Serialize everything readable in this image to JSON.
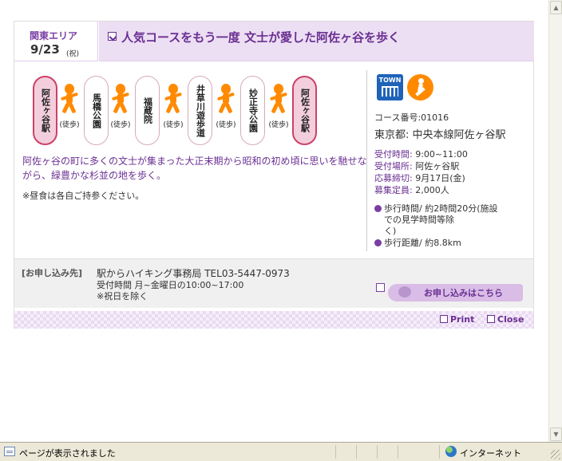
{
  "header": {
    "area": "関東エリア",
    "date": "9/23",
    "day": "(祝)",
    "title": "人気コースをもう一度 文士が愛した阿佐ヶ谷を歩く"
  },
  "route": {
    "stations": [
      "阿佐ヶ谷駅",
      "馬橋公園",
      "福蔵院",
      "井草川遊歩道",
      "妙正寺公園",
      "阿佐ヶ谷駅"
    ],
    "walk_label": "(徒歩)"
  },
  "description": "阿佐ヶ谷の町に多くの文士が集まった大正末期から昭和の初め頃に思いを馳せながら、緑豊かな杉並の地を歩く。",
  "note": "※昼食は各自ご持参ください。",
  "side": {
    "town_icon_label": "TOWN",
    "course_no": "コース番号:01016",
    "place": "東京都: 中央本線阿佐ヶ谷駅",
    "reception_time_label": "受付時間: ",
    "reception_time": "9:00~11:00",
    "reception_place_label": "受付場所: ",
    "reception_place": "阿佐ヶ谷駅",
    "deadline_label": "応募締切: ",
    "deadline": "9月17日(金)",
    "capacity_label": "募集定員: ",
    "capacity": "2,000人",
    "walk_time_1": "歩行時間/ 約2時間20分(施設",
    "walk_time_2": "での見学時間等除",
    "walk_time_3": "く)",
    "distance": "歩行距離/ 約8.8km"
  },
  "apply": {
    "label": "[お申し込み先]",
    "line1": "駅からハイキング事務局 TEL03-5447-0973",
    "line2": "受付時間 月~金曜日の10:00~17:00",
    "line3": "※祝日を除く",
    "button": "お申し込みはこちら"
  },
  "footer": {
    "print": "Print",
    "close": "Close"
  },
  "statusbar": {
    "text": "ページが表示されました",
    "zone": "インターネット"
  }
}
